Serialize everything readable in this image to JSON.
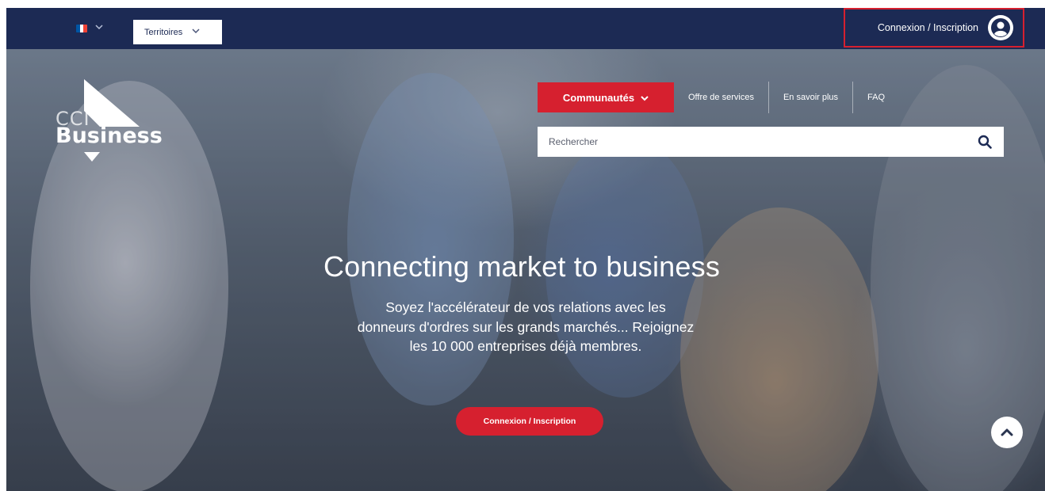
{
  "topbar": {
    "language": {
      "flag_colors": [
        "#0055a4",
        "#ffffff",
        "#ef4135"
      ],
      "icon": "chevron-down-icon"
    },
    "territoires_label": "Territoires",
    "login_label": "Connexion / Inscription",
    "login_icon": "user-circle-icon"
  },
  "logo": {
    "small_text": "CCI",
    "big_text": "Business"
  },
  "nav": {
    "communautes_label": "Communautés",
    "items": [
      {
        "label": "Offre de services"
      },
      {
        "label": "En savoir plus"
      },
      {
        "label": "FAQ"
      }
    ]
  },
  "search": {
    "placeholder": "Rechercher",
    "icon": "search-icon"
  },
  "hero": {
    "headline": "Connecting market to business",
    "subtext": "Soyez l'accélérateur de vos relations avec les donneurs d'ordres sur les grands marchés... Rejoignez les 10 000 entreprises déjà membres.",
    "cta_label": "Connexion / Inscription"
  },
  "colors": {
    "navy": "#1c2a54",
    "accent_red": "#d6202f",
    "white": "#ffffff"
  }
}
